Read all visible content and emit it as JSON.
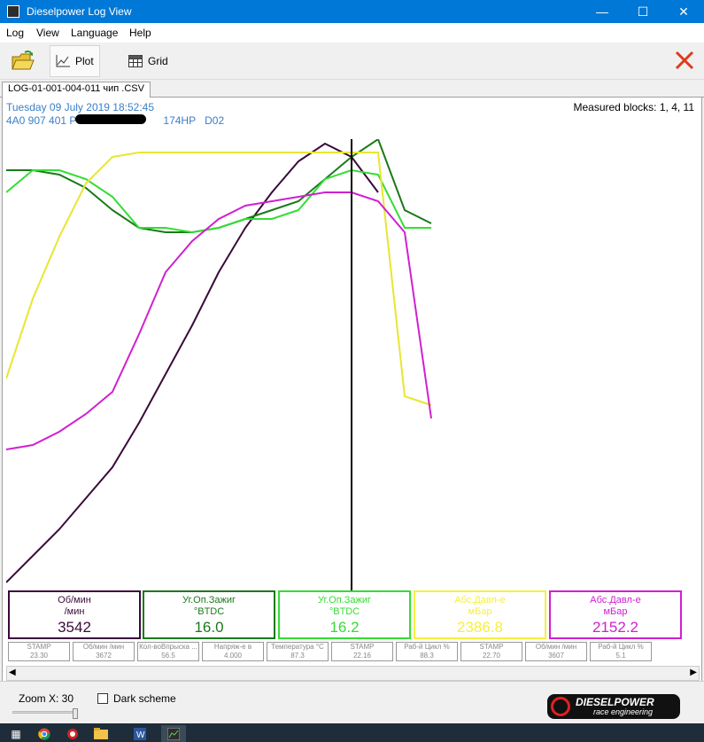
{
  "window": {
    "title": "Dieselpower Log View"
  },
  "menu": [
    "Log",
    "View",
    "Language",
    "Help"
  ],
  "toolbar": {
    "plot_label": "Plot",
    "grid_label": "Grid"
  },
  "tab": {
    "label": "LOG-01-001-004-011 чип .CSV"
  },
  "info": {
    "date": "Tuesday 09 July 2019 18:52:45",
    "vehicle_prefix": "4A0 907 401 P",
    "vehicle_suffix": "174HP",
    "vehicle_code": "D02",
    "measured_blocks": "Measured blocks: 1, 4, 11"
  },
  "gauges": [
    {
      "name1": "Об/мин",
      "name2": "/мин",
      "value": "3542",
      "color": "#3a0a3a"
    },
    {
      "name1": "Уг.Оп.Зажиг",
      "name2": "°BTDC",
      "value": "16.0",
      "color": "#1a7a1a"
    },
    {
      "name1": "Уг.Оп.Зажиг",
      "name2": "°BTDC",
      "value": "16.2",
      "color": "#33dd33"
    },
    {
      "name1": "Абс.Давл-е",
      "name2": "мБар",
      "value": "2386.8",
      "color": "#f5f040"
    },
    {
      "name1": "Абс.Давл-е",
      "name2": "мБар",
      "value": "2152.2",
      "color": "#d020d0"
    }
  ],
  "mini_boxes": [
    {
      "label": "STAMP",
      "value": "23.30"
    },
    {
      "label": "Об/мин /мин",
      "value": "3672"
    },
    {
      "label": "Кол-воВпрыска ...",
      "value": "56.5"
    },
    {
      "label": "Напряж-е в",
      "value": "4.000"
    },
    {
      "label": "Темпеpатура °C",
      "value": "87.3"
    },
    {
      "label": "STAMP",
      "value": "22.16"
    },
    {
      "label": "Раб-й Цикл %",
      "value": "88.3"
    },
    {
      "label": "STAMP",
      "value": "22.70"
    },
    {
      "label": "Об/мин /мин",
      "value": "3607"
    },
    {
      "label": "Раб-й Цикл %",
      "value": "5.1"
    }
  ],
  "status": {
    "zoom_label": "Zoom X: 30",
    "zoom_value": 30,
    "dark_scheme_label": "Dark scheme",
    "dark_scheme_checked": false
  },
  "brand": {
    "name": "DIESELPOWER",
    "tagline": "race engineering",
    "url": "http://www.dieselpower.cz"
  },
  "chart_data": {
    "type": "line",
    "x": [
      0,
      1,
      2,
      3,
      4,
      5,
      6,
      7,
      8,
      9,
      10,
      11,
      12,
      13,
      14,
      15,
      16,
      17
    ],
    "cursor_index": 13,
    "series": [
      {
        "color": "#3a0a3a",
        "values": [
          0.0,
          0.06,
          0.12,
          0.19,
          0.26,
          0.36,
          0.47,
          0.58,
          0.7,
          0.8,
          0.88,
          0.95,
          0.99,
          0.96,
          0.88
        ]
      },
      {
        "color": "#1a7a1a",
        "values": [
          0.93,
          0.93,
          0.92,
          0.89,
          0.84,
          0.8,
          0.79,
          0.79,
          0.8,
          0.82,
          0.84,
          0.86,
          0.91,
          0.96,
          1.0,
          0.84,
          0.81
        ]
      },
      {
        "color": "#33dd33",
        "values": [
          0.88,
          0.93,
          0.93,
          0.91,
          0.87,
          0.8,
          0.8,
          0.79,
          0.8,
          0.82,
          0.82,
          0.84,
          0.91,
          0.93,
          0.92,
          0.8,
          0.8
        ]
      },
      {
        "color": "#f5f040",
        "values": [
          0.46,
          0.64,
          0.78,
          0.9,
          0.96,
          0.97,
          0.97,
          0.97,
          0.97,
          0.97,
          0.97,
          0.97,
          0.97,
          0.97,
          0.97,
          0.42,
          0.4
        ]
      },
      {
        "color": "#d020d0",
        "values": [
          0.3,
          0.31,
          0.34,
          0.38,
          0.43,
          0.56,
          0.7,
          0.77,
          0.82,
          0.85,
          0.86,
          0.87,
          0.88,
          0.88,
          0.86,
          0.79,
          0.37
        ]
      }
    ]
  }
}
